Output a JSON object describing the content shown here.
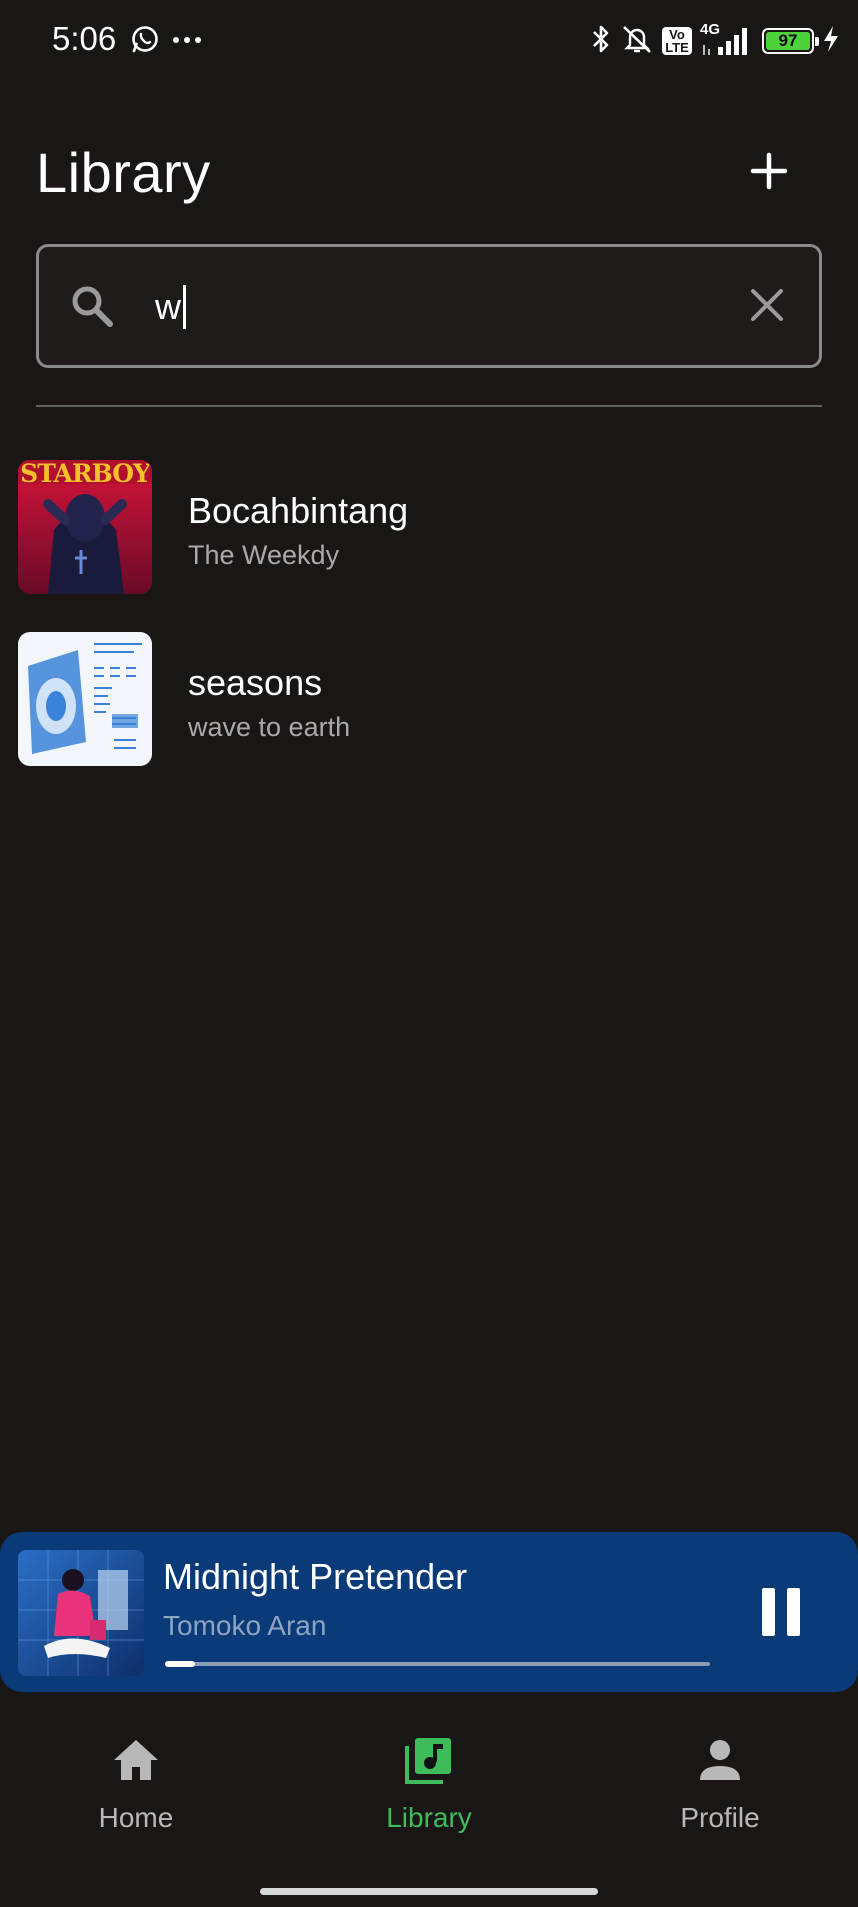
{
  "status_bar": {
    "time": "5:06",
    "network": "4G",
    "volte": "Vo LTE",
    "battery": "97"
  },
  "header": {
    "title": "Library",
    "add_icon": "plus-icon"
  },
  "search": {
    "value": "w",
    "search_icon": "search-icon",
    "clear_icon": "close-icon"
  },
  "songs": [
    {
      "title": "Bocahbintang",
      "artist": "The Weekdy",
      "cover_text": "STARBOY"
    },
    {
      "title": "seasons",
      "artist": "wave to earth"
    }
  ],
  "now_playing": {
    "title": "Midnight Pretender",
    "artist": "Tomoko Aran",
    "progress": 0.055,
    "state": "playing",
    "control_icon": "pause-icon",
    "background": "#0a3a78"
  },
  "nav": {
    "items": [
      {
        "label": "Home",
        "icon": "home-icon"
      },
      {
        "label": "Library",
        "icon": "library-music-icon",
        "active": true
      },
      {
        "label": "Profile",
        "icon": "person-icon"
      }
    ],
    "active_color": "#3ebb5a"
  }
}
